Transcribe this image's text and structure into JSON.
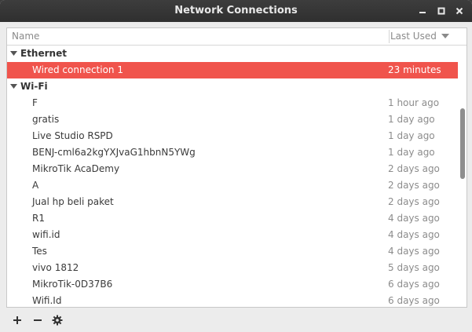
{
  "window": {
    "title": "Network Connections"
  },
  "columns": {
    "name": "Name",
    "last_used": "Last Used"
  },
  "groups": [
    {
      "label": "Ethernet",
      "items": [
        {
          "name": "Wired connection 1",
          "last_used": "23 minutes ago",
          "selected": true
        }
      ]
    },
    {
      "label": "Wi-Fi",
      "items": [
        {
          "name": "F",
          "last_used": "1 hour ago"
        },
        {
          "name": "gratis",
          "last_used": "1 day ago"
        },
        {
          "name": "Live Studio RSPD",
          "last_used": "1 day ago"
        },
        {
          "name": "BENJ-cml6a2kgYXJvaG1hbnN5YWg",
          "last_used": "1 day ago"
        },
        {
          "name": "MikroTik AcaDemy",
          "last_used": "2 days ago"
        },
        {
          "name": "A",
          "last_used": "2 days ago"
        },
        {
          "name": "Jual hp beli paket",
          "last_used": "2 days ago"
        },
        {
          "name": "R1",
          "last_used": "4 days ago"
        },
        {
          "name": "wifi.id",
          "last_used": "4 days ago"
        },
        {
          "name": "Tes",
          "last_used": "4 days ago"
        },
        {
          "name": "vivo 1812",
          "last_used": "5 days ago"
        },
        {
          "name": "MikroTik-0D37B6",
          "last_used": "6 days ago"
        },
        {
          "name": "Wifi.Id",
          "last_used": "6 days ago"
        }
      ]
    }
  ],
  "toolbar": {
    "add_icon": "plus-icon",
    "remove_icon": "minus-icon",
    "settings_icon": "gear-icon"
  },
  "colors": {
    "selection": "#f0544c",
    "titlebar": "#333333"
  }
}
